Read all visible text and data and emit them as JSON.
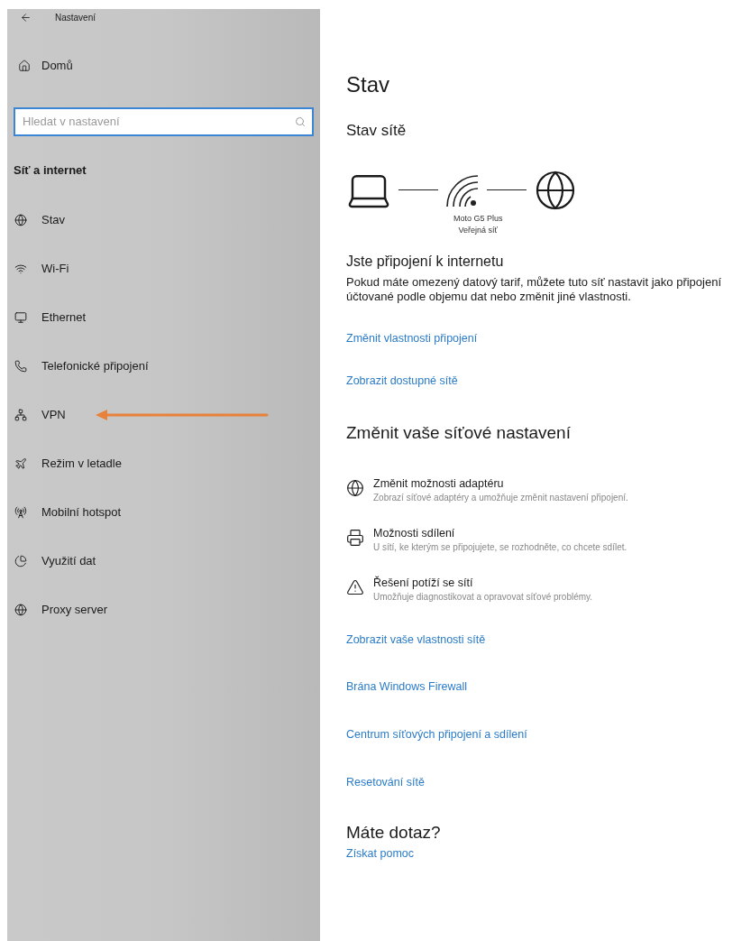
{
  "window": {
    "title": "Nastavení"
  },
  "sidebar": {
    "home": "Domů",
    "search": {
      "placeholder": "Hledat v nastavení"
    },
    "section": "Síť a internet",
    "items": [
      {
        "label": "Stav"
      },
      {
        "label": "Wi-Fi"
      },
      {
        "label": "Ethernet"
      },
      {
        "label": "Telefonické připojení"
      },
      {
        "label": "VPN",
        "annotated": true
      },
      {
        "label": "Režim v letadle"
      },
      {
        "label": "Mobilní hotspot"
      },
      {
        "label": "Využití dat"
      },
      {
        "label": "Proxy server"
      }
    ]
  },
  "content": {
    "title": "Stav",
    "network_status": {
      "heading": "Stav sítě",
      "network_name": "Moto G5 Plus",
      "network_type": "Veřejná síť"
    },
    "connected": {
      "heading": "Jste připojení k internetu",
      "text": "Pokud máte omezený datový tarif, můžete tuto síť nastavit jako připojení účtované podle objemu dat nebo změnit jiné vlastnosti.",
      "links": [
        "Změnit vlastnosti připojení",
        "Zobrazit dostupné sítě"
      ]
    },
    "change_settings": {
      "heading": "Změnit vaše síťové nastavení",
      "options": [
        {
          "title": "Změnit možnosti adaptéru",
          "description": "Zobrazí síťové adaptéry a umožňuje změnit nastavení připojení."
        },
        {
          "title": "Možnosti sdílení",
          "description": "U sítí, ke kterým se připojujete, se rozhodněte, co chcete sdílet."
        },
        {
          "title": "Řešení potíží se sítí",
          "description": "Umožňuje diagnostikovat a opravovat síťové problémy."
        }
      ],
      "links": [
        "Zobrazit vaše vlastnosti sítě",
        "Brána Windows Firewall",
        "Centrum síťových připojení a sdílení",
        "Resetování sítě"
      ]
    },
    "help": {
      "heading": "Máte dotaz?",
      "link": "Získat pomoc"
    }
  }
}
